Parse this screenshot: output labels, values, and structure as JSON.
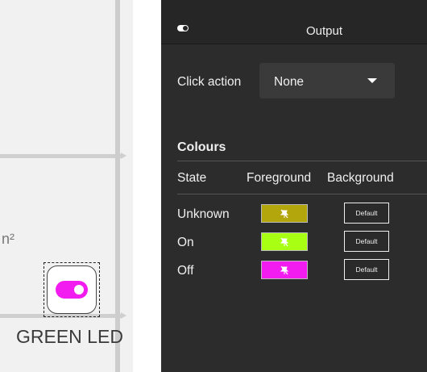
{
  "canvas": {
    "area_unit": "n²",
    "led_label": "GREEN LED",
    "led_color": "#f21cf0"
  },
  "panel": {
    "title": "Output",
    "title_icon": "toggle-icon",
    "click_action": {
      "label": "Click action",
      "value": "None"
    },
    "colours": {
      "heading": "Colours",
      "columns": {
        "state": "State",
        "foreground": "Foreground",
        "background": "Background"
      },
      "rows": [
        {
          "state": "Unknown",
          "foreground": "#b3a50c",
          "background_label": "Default"
        },
        {
          "state": "On",
          "foreground": "#a8ff14",
          "background_label": "Default"
        },
        {
          "state": "Off",
          "foreground": "#f21cf0",
          "background_label": "Default"
        }
      ]
    }
  }
}
